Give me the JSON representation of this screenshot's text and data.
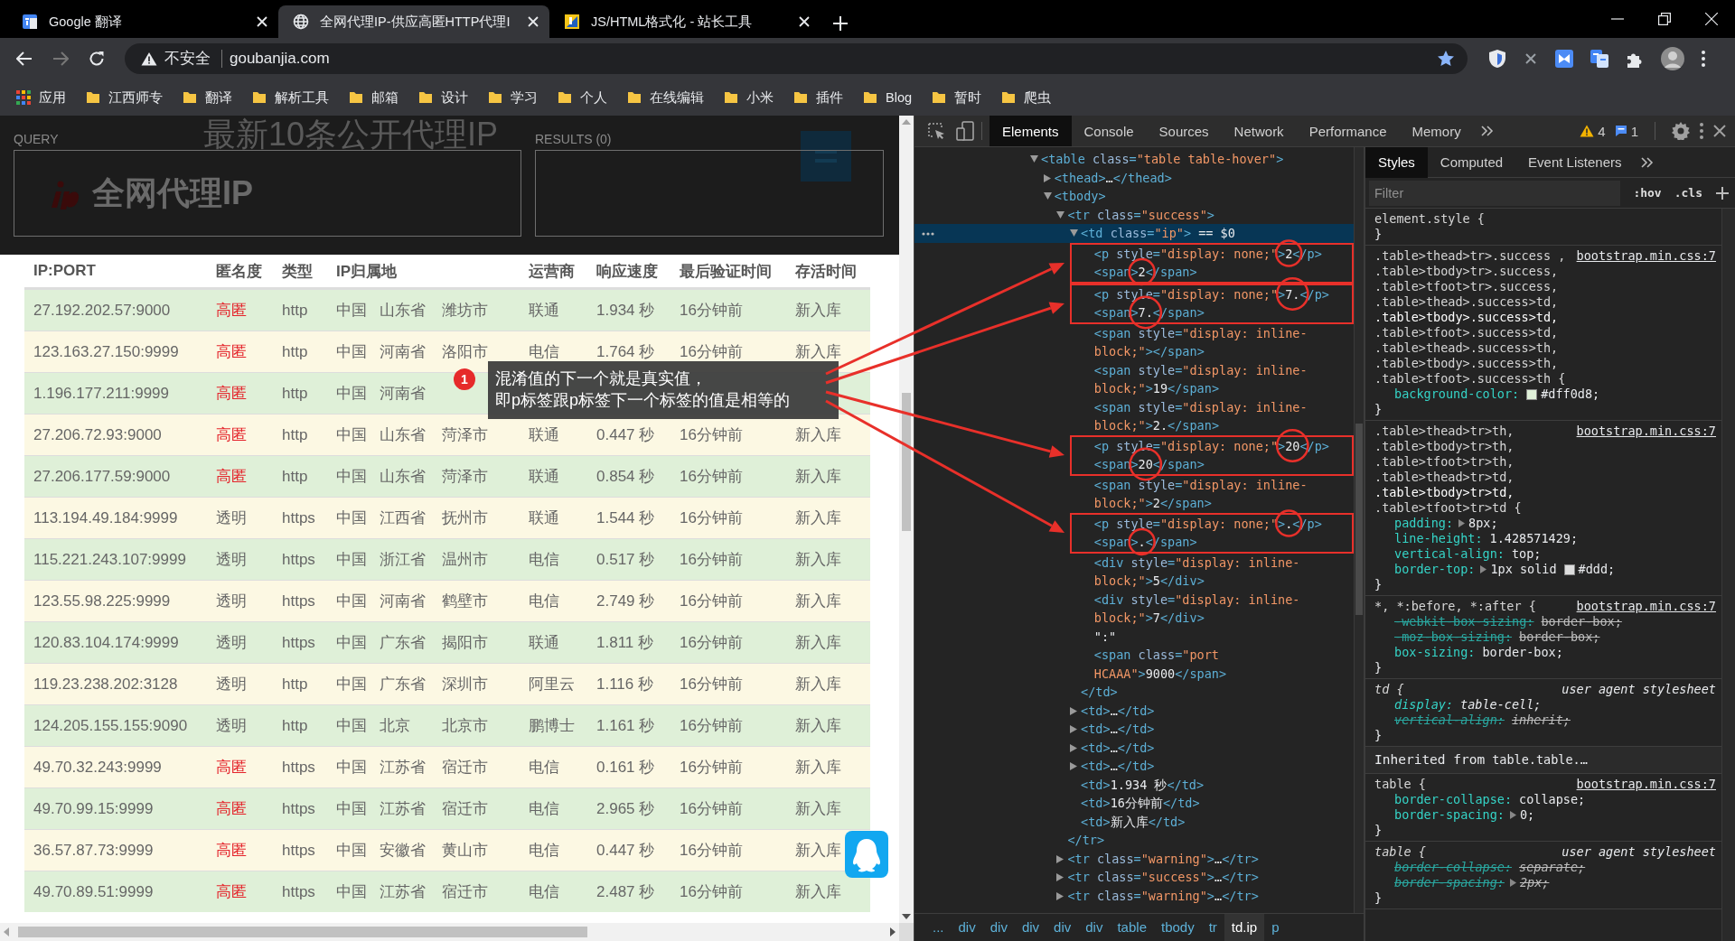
{
  "browser": {
    "tabs": [
      {
        "title": "Google 翻译",
        "kind": "translate",
        "selected": false
      },
      {
        "title": "全网代理IP-供应高匿HTTP代理I",
        "kind": "globe",
        "selected": true
      },
      {
        "title": "JS/HTML格式化 - 站长工具",
        "kind": "tool",
        "selected": false
      }
    ],
    "security_label": "不安全",
    "url": "goubanjia.com",
    "bookmarks": [
      {
        "label": "应用",
        "kind": "apps"
      },
      {
        "label": "江西师专",
        "kind": "folder"
      },
      {
        "label": "翻译",
        "kind": "folder"
      },
      {
        "label": "解析工具",
        "kind": "folder"
      },
      {
        "label": "邮箱",
        "kind": "folder"
      },
      {
        "label": "设计",
        "kind": "folder"
      },
      {
        "label": "学习",
        "kind": "folder"
      },
      {
        "label": "个人",
        "kind": "folder"
      },
      {
        "label": "在线编辑",
        "kind": "folder"
      },
      {
        "label": "小米",
        "kind": "folder"
      },
      {
        "label": "插件",
        "kind": "folder"
      },
      {
        "label": "Blog",
        "kind": "folder"
      },
      {
        "label": "暂时",
        "kind": "folder"
      },
      {
        "label": "爬虫",
        "kind": "folder"
      }
    ]
  },
  "page": {
    "heading": "最新10条公开代理IP",
    "logo_text": "全网代理IP",
    "query_label": "QUERY",
    "results_label": "RESULTS (0)",
    "table": {
      "columns": [
        "IP:PORT",
        "匿名度",
        "类型",
        "IP归属地",
        "运营商",
        "响应速度",
        "最后验证时间",
        "存活时间"
      ],
      "rows": [
        {
          "warning": false,
          "ip_port": "27.192.202.57:9000",
          "anonymity": "高匿",
          "highlighted": true,
          "type": "http",
          "location": [
            "中国",
            "山东省",
            "潍坊市"
          ],
          "isp": "联通",
          "speed": "1.934 秒",
          "last_verified": "16分钟前",
          "uptime": "新入库"
        },
        {
          "warning": true,
          "ip_port": "123.163.27.150:9999",
          "anonymity": "高匿",
          "highlighted": true,
          "type": "http",
          "location": [
            "中国",
            "河南省",
            "洛阳市"
          ],
          "isp": "电信",
          "speed": "1.764 秒",
          "last_verified": "16分钟前",
          "uptime": "新入库"
        },
        {
          "warning": false,
          "ip_port": "1.196.177.211:9999",
          "anonymity": "高匿",
          "highlighted": true,
          "type": "http",
          "location": [
            "中国",
            "河南省"
          ]
        },
        {
          "warning": true,
          "ip_port": "27.206.72.93:9000",
          "anonymity": "高匿",
          "highlighted": true,
          "type": "http",
          "location": [
            "中国",
            "山东省",
            "菏泽市"
          ],
          "isp": "联通",
          "speed": "0.447 秒",
          "last_verified": "16分钟前",
          "uptime": "新入库"
        },
        {
          "warning": false,
          "ip_port": "27.206.177.59:9000",
          "anonymity": "高匿",
          "highlighted": true,
          "type": "http",
          "location": [
            "中国",
            "山东省",
            "菏泽市"
          ],
          "isp": "联通",
          "speed": "0.854 秒",
          "last_verified": "16分钟前",
          "uptime": "新入库"
        },
        {
          "warning": true,
          "ip_port": "113.194.49.184:9999",
          "anonymity": "透明",
          "highlighted": false,
          "type": "https",
          "location": [
            "中国",
            "江西省",
            "抚州市"
          ],
          "isp": "联通",
          "speed": "1.544 秒",
          "last_verified": "16分钟前",
          "uptime": "新入库"
        },
        {
          "warning": false,
          "ip_port": "115.221.243.107:9999",
          "anonymity": "透明",
          "highlighted": false,
          "type": "https",
          "location": [
            "中国",
            "浙江省",
            "温州市"
          ],
          "isp": "电信",
          "speed": "0.517 秒",
          "last_verified": "16分钟前",
          "uptime": "新入库"
        },
        {
          "warning": true,
          "ip_port": "123.55.98.225:9999",
          "anonymity": "透明",
          "highlighted": false,
          "type": "https",
          "location": [
            "中国",
            "河南省",
            "鹤壁市"
          ],
          "isp": "电信",
          "speed": "2.749 秒",
          "last_verified": "16分钟前",
          "uptime": "新入库"
        },
        {
          "warning": false,
          "ip_port": "120.83.104.174:9999",
          "anonymity": "透明",
          "highlighted": false,
          "type": "https",
          "location": [
            "中国",
            "广东省",
            "揭阳市"
          ],
          "isp": "联通",
          "speed": "1.811 秒",
          "last_verified": "16分钟前",
          "uptime": "新入库"
        },
        {
          "warning": true,
          "ip_port": "119.23.238.202:3128",
          "anonymity": "透明",
          "highlighted": false,
          "type": "http",
          "location": [
            "中国",
            "广东省",
            "深圳市"
          ],
          "isp": "阿里云",
          "speed": "1.116 秒",
          "last_verified": "16分钟前",
          "uptime": "新入库"
        },
        {
          "warning": false,
          "ip_port": "124.205.155.155:9090",
          "anonymity": "透明",
          "highlighted": false,
          "type": "http",
          "location": [
            "中国",
            "北京",
            "北京市"
          ],
          "isp": "鹏博士",
          "speed": "1.161 秒",
          "last_verified": "16分钟前",
          "uptime": "新入库"
        },
        {
          "warning": true,
          "ip_port": "49.70.32.243:9999",
          "anonymity": "高匿",
          "highlighted": true,
          "type": "https",
          "location": [
            "中国",
            "江苏省",
            "宿迁市"
          ],
          "isp": "电信",
          "speed": "0.161 秒",
          "last_verified": "16分钟前",
          "uptime": "新入库"
        },
        {
          "warning": false,
          "ip_port": "49.70.99.15:9999",
          "anonymity": "高匿",
          "highlighted": true,
          "type": "https",
          "location": [
            "中国",
            "江苏省",
            "宿迁市"
          ],
          "isp": "电信",
          "speed": "2.965 秒",
          "last_verified": "16分钟前",
          "uptime": "新入库"
        },
        {
          "warning": true,
          "ip_port": "36.57.87.73:9999",
          "anonymity": "高匿",
          "highlighted": true,
          "type": "https",
          "location": [
            "中国",
            "安徽省",
            "黄山市"
          ],
          "isp": "电信",
          "speed": "0.447 秒",
          "last_verified": "16分钟前",
          "uptime": "新入库"
        },
        {
          "warning": false,
          "ip_port": "49.70.89.51:9999",
          "anonymity": "高匿",
          "highlighted": true,
          "type": "https",
          "location": [
            "中国",
            "江苏省",
            "宿迁市"
          ],
          "isp": "电信",
          "speed": "2.487 秒",
          "last_verified": "16分钟前",
          "uptime": "新入库"
        }
      ]
    },
    "callout": {
      "badge": "1",
      "lines": [
        "混淆值的下一个就是真实值，",
        "即p标签跟p标签下一个标签的值是相等的"
      ]
    }
  },
  "devtools": {
    "tabs": [
      {
        "label": "Elements",
        "selected": true
      },
      {
        "label": "Console",
        "selected": false
      },
      {
        "label": "Sources",
        "selected": false
      },
      {
        "label": "Network",
        "selected": false
      },
      {
        "label": "Performance",
        "selected": false
      },
      {
        "label": "Memory",
        "selected": false
      }
    ],
    "warnings": "4",
    "messages": "1",
    "dom_tree": [
      {
        "text": "<table class=\"table table-hover\">",
        "expanded": true,
        "selected": false,
        "children": [
          {
            "text": "<thead>…</thead>",
            "expanded": false,
            "selected": false
          },
          {
            "text": "<tbody>",
            "expanded": true,
            "selected": false,
            "children": [
              {
                "text": "<tr class=\"success\">",
                "expanded": true,
                "selected": false,
                "closing": "</tr>",
                "children": [
                  {
                    "text": "<td class=\"ip\"> == $0",
                    "expanded": true,
                    "selected": true,
                    "closing": "</td>",
                    "children": [
                      {
                        "text": "<p style=\"display: none;\">2</p>",
                        "selected": false,
                        "boxed_pair": true
                      },
                      {
                        "text": "<span>2</span>",
                        "selected": false,
                        "boxed_pair": true
                      },
                      {
                        "text": "<p style=\"display: none;\">7.</p>",
                        "selected": false,
                        "boxed_pair": true
                      },
                      {
                        "text": "<span>7.</span>",
                        "selected": false,
                        "boxed_pair": true
                      },
                      {
                        "text": "<span style=\"display: inline-block;\"></span>",
                        "selected": false,
                        "boxed_pair": false
                      },
                      {
                        "text": "<span style=\"display: inline-block;\">19</span>",
                        "selected": false,
                        "boxed_pair": false
                      },
                      {
                        "text": "<span style=\"display: inline-block;\">2.</span>",
                        "selected": false,
                        "boxed_pair": false
                      },
                      {
                        "text": "<p style=\"display: none;\">20</p>",
                        "selected": false,
                        "boxed_pair": true
                      },
                      {
                        "text": "<span>20</span>",
                        "selected": false,
                        "boxed_pair": true
                      },
                      {
                        "text": "<span style=\"display: inline-block;\">2</span>",
                        "selected": false,
                        "boxed_pair": false
                      },
                      {
                        "text": "<p style=\"display: none;\">.</p>",
                        "selected": false,
                        "boxed_pair": true
                      },
                      {
                        "text": "<span>.</span>",
                        "selected": false,
                        "boxed_pair": true
                      },
                      {
                        "text": "<div style=\"display: inline-block;\">5</div>",
                        "selected": false,
                        "boxed_pair": false
                      },
                      {
                        "text": "<div style=\"display: inline-block;\">7</div>",
                        "selected": false,
                        "boxed_pair": false
                      },
                      {
                        "text": "\":\"",
                        "selected": false,
                        "boxed_pair": false
                      },
                      {
                        "text": "<span class=\"port HCAAA\">9000</span>",
                        "selected": false,
                        "boxed_pair": false
                      }
                    ]
                  },
                  {
                    "text": "<td>…</td>",
                    "expanded": false,
                    "selected": false
                  },
                  {
                    "text": "<td>…</td>",
                    "expanded": false,
                    "selected": false
                  },
                  {
                    "text": "<td>…</td>",
                    "expanded": false,
                    "selected": false
                  },
                  {
                    "text": "<td>…</td>",
                    "expanded": false,
                    "selected": false
                  },
                  {
                    "text": "<td>1.934 秒</td>",
                    "selected": false
                  },
                  {
                    "text": "<td>16分钟前</td>",
                    "selected": false
                  },
                  {
                    "text": "<td>新入库</td>",
                    "selected": false
                  }
                ]
              },
              {
                "text": "<tr class=\"warning\">…</tr>",
                "expanded": false,
                "selected": false
              },
              {
                "text": "<tr class=\"success\">…</tr>",
                "expanded": false,
                "selected": false
              },
              {
                "text": "<tr class=\"warning\">…</tr>",
                "expanded": false,
                "selected": false
              }
            ]
          }
        ]
      }
    ],
    "breadcrumbs": [
      {
        "label": "...",
        "selected": false
      },
      {
        "label": "div",
        "selected": false
      },
      {
        "label": "div",
        "selected": false
      },
      {
        "label": "div",
        "selected": false
      },
      {
        "label": "div",
        "selected": false
      },
      {
        "label": "div",
        "selected": false
      },
      {
        "label": "table",
        "selected": false
      },
      {
        "label": "tbody",
        "selected": false
      },
      {
        "label": "tr",
        "selected": false
      },
      {
        "label": "td.ip",
        "selected": true
      },
      {
        "label": "p",
        "selected": false
      }
    ],
    "styles_tabs": [
      {
        "label": "Styles",
        "selected": true
      },
      {
        "label": "Computed",
        "selected": false
      },
      {
        "label": "Event Listeners",
        "selected": false
      }
    ],
    "filter_placeholder": "Filter",
    "hov": ":hov",
    "cls": ".cls",
    "rules": [
      {
        "kind": "inline",
        "selector": "element.style {",
        "closing": "}"
      },
      {
        "kind": "author",
        "selector": ".table>thead>tr>.success , .table>tbody>tr>.success, .table>tfoot>tr>.success, .table>thead>.success>td, **.table>tbody>.success>td,** .table>tfoot>.success>td, .table>thead>.success>th, .table>tbody>.success>th, .table>tfoot>.success>th {",
        "source": "bootstrap.min.css:7",
        "closing": "}",
        "properties": [
          {
            "name": "background-color:",
            "value": "#dff0d8;",
            "color": "#dff0d8",
            "expandable": false,
            "overridden": false
          }
        ]
      },
      {
        "kind": "author",
        "selector": ".table>thead>tr>th, .table>tbody>tr>th, .table>tfoot>tr>th, .table>thead>tr>td, **.table>tbody>tr>td,** .table>tfoot>tr>td {",
        "source": "bootstrap.min.css:7",
        "closing": "}",
        "properties": [
          {
            "name": "padding:",
            "value": "8px;",
            "expandable": true,
            "overridden": false
          },
          {
            "name": "line-height:",
            "value": "1.428571429;",
            "expandable": false,
            "overridden": false
          },
          {
            "name": "vertical-align:",
            "value": "top;",
            "expandable": false,
            "overridden": false
          },
          {
            "name": "border-top:",
            "value": "1px solid",
            "value2": "#ddd;",
            "color": "#dddddd",
            "expandable": true,
            "overridden": false
          }
        ]
      },
      {
        "kind": "author",
        "selector": "*, *:before, *:after {",
        "source": "bootstrap.min.css:7",
        "closing": "}",
        "properties": [
          {
            "name": "-webkit-box-sizing:",
            "value": "border-box;",
            "expandable": false,
            "overridden": true
          },
          {
            "name": "-moz-box-sizing:",
            "value": "border-box;",
            "expandable": false,
            "overridden": true
          },
          {
            "name": "box-sizing:",
            "value": "border-box;",
            "expandable": false,
            "overridden": false
          }
        ]
      },
      {
        "kind": "user-agent",
        "selector": "td {",
        "source": "user agent stylesheet",
        "closing": "}",
        "properties": [
          {
            "name": "display:",
            "value": "table-cell;",
            "expandable": false,
            "overridden": false
          },
          {
            "name": "vertical-align:",
            "value": "inherit;",
            "expandable": false,
            "overridden": true
          }
        ]
      },
      {
        "kind": "inherited",
        "label": "Inherited from",
        "node": "table.table.…"
      },
      {
        "kind": "author",
        "selector": "table {",
        "source": "bootstrap.min.css:7",
        "closing": "}",
        "properties": [
          {
            "name": "border-collapse:",
            "value": "collapse;",
            "expandable": false,
            "overridden": false
          },
          {
            "name": "border-spacing:",
            "value": "0;",
            "expandable": true,
            "overridden": false
          }
        ]
      },
      {
        "kind": "user-agent",
        "selector": "table {",
        "source": "user agent stylesheet",
        "closing": "}",
        "properties": [
          {
            "name": "border-collapse:",
            "value": "separate;",
            "expandable": false,
            "overridden": true
          },
          {
            "name": "border-spacing:",
            "value": "2px;",
            "expandable": true,
            "overridden": true
          }
        ]
      }
    ]
  }
}
